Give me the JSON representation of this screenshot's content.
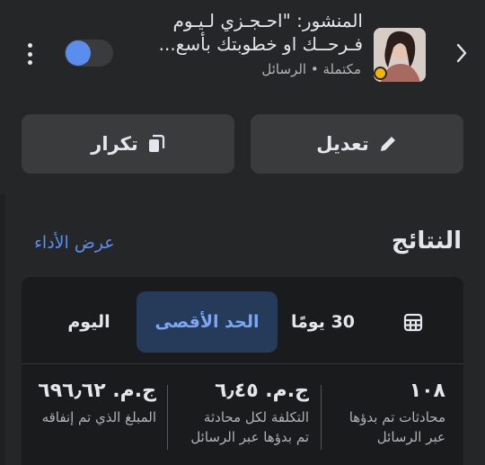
{
  "header": {
    "post_title_line1": "المنشور: \"احـجـزي لـيـوم",
    "post_title_line2": "فـرحــك او خطوبتك بأسع...",
    "status_text": "مكتملة • الرسائل",
    "status_color": "#f5b400",
    "toggle_color": "#5b8def"
  },
  "actions": {
    "edit_label": "تعديل",
    "duplicate_label": "تكرار"
  },
  "results": {
    "title": "النتائج",
    "view_performance_link": "عرض الأداء"
  },
  "date_tabs": {
    "days_30": "30 يومًا",
    "maximum": "الحد الأقصى",
    "today": "اليوم",
    "selected": "maximum"
  },
  "metrics": [
    {
      "value": "١٠٨",
      "label_line1": "محادثات تم بدؤها",
      "label_line2": "عبر الرسائل"
    },
    {
      "value": "ج.م. ٦٫٤٥",
      "label_line1": "التكلفة لكل محادثة",
      "label_line2": "تم بدؤها عبر الرسائل"
    },
    {
      "value": "ج.م. ٦٩٦٫٦٢",
      "label_line1": "المبلغ الذي تم إنفاقه",
      "label_line2": ""
    }
  ]
}
